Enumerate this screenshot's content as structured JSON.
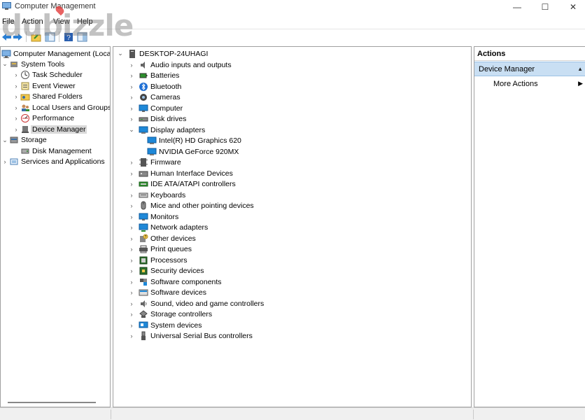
{
  "window": {
    "title": "Computer Management",
    "min_glyph": "—",
    "max_glyph": "☐",
    "close_glyph": "✕"
  },
  "menu": [
    "File",
    "Action",
    "View",
    "Help"
  ],
  "toolbar": {
    "buttons": [
      "back-arrow-icon",
      "forward-arrow-icon",
      "up-folder-icon",
      "show-hide-tree-icon",
      "help-icon",
      "console-icon"
    ]
  },
  "left_tree": {
    "root": "Computer Management (Local",
    "items": [
      {
        "label": "System Tools",
        "level": 1,
        "expanded": true
      },
      {
        "label": "Task Scheduler",
        "level": 2
      },
      {
        "label": "Event Viewer",
        "level": 2
      },
      {
        "label": "Shared Folders",
        "level": 2
      },
      {
        "label": "Local Users and Groups",
        "level": 2
      },
      {
        "label": "Performance",
        "level": 2
      },
      {
        "label": "Device Manager",
        "level": 2,
        "selected": true
      },
      {
        "label": "Storage",
        "level": 1,
        "expanded": true
      },
      {
        "label": "Disk Management",
        "level": 2
      },
      {
        "label": "Services and Applications",
        "level": 1
      }
    ]
  },
  "device_tree": {
    "root": "DESKTOP-24UHAGI",
    "categories": [
      {
        "label": "Audio inputs and outputs",
        "icon": "speaker-icon"
      },
      {
        "label": "Batteries",
        "icon": "battery-icon"
      },
      {
        "label": "Bluetooth",
        "icon": "bluetooth-icon"
      },
      {
        "label": "Cameras",
        "icon": "camera-icon"
      },
      {
        "label": "Computer",
        "icon": "computer-icon"
      },
      {
        "label": "Disk drives",
        "icon": "disk-drive-icon"
      },
      {
        "label": "Display adapters",
        "icon": "display-adapter-icon",
        "expanded": true,
        "children": [
          "Intel(R) HD Graphics 620",
          "NVIDIA GeForce 920MX"
        ]
      },
      {
        "label": "Firmware",
        "icon": "firmware-icon"
      },
      {
        "label": "Human Interface Devices",
        "icon": "hid-icon"
      },
      {
        "label": "IDE ATA/ATAPI controllers",
        "icon": "ide-controller-icon"
      },
      {
        "label": "Keyboards",
        "icon": "keyboard-icon"
      },
      {
        "label": "Mice and other pointing devices",
        "icon": "mouse-icon"
      },
      {
        "label": "Monitors",
        "icon": "monitor-icon"
      },
      {
        "label": "Network adapters",
        "icon": "network-adapter-icon"
      },
      {
        "label": "Other devices",
        "icon": "other-devices-icon"
      },
      {
        "label": "Print queues",
        "icon": "printer-icon"
      },
      {
        "label": "Processors",
        "icon": "processor-icon"
      },
      {
        "label": "Security devices",
        "icon": "security-device-icon"
      },
      {
        "label": "Software components",
        "icon": "software-component-icon"
      },
      {
        "label": "Software devices",
        "icon": "software-device-icon"
      },
      {
        "label": "Sound, video and game controllers",
        "icon": "sound-controller-icon"
      },
      {
        "label": "Storage controllers",
        "icon": "storage-controller-icon"
      },
      {
        "label": "System devices",
        "icon": "system-device-icon"
      },
      {
        "label": "Universal Serial Bus controllers",
        "icon": "usb-controller-icon"
      }
    ]
  },
  "actions": {
    "header": "Actions",
    "section": "Device Manager",
    "items": [
      "More Actions"
    ]
  },
  "watermark": "dubizzle",
  "colors": {
    "selection": "#d9d9d9",
    "actions_section_bg": "#c9dff3",
    "monitor_blue": "#1e88d8"
  }
}
